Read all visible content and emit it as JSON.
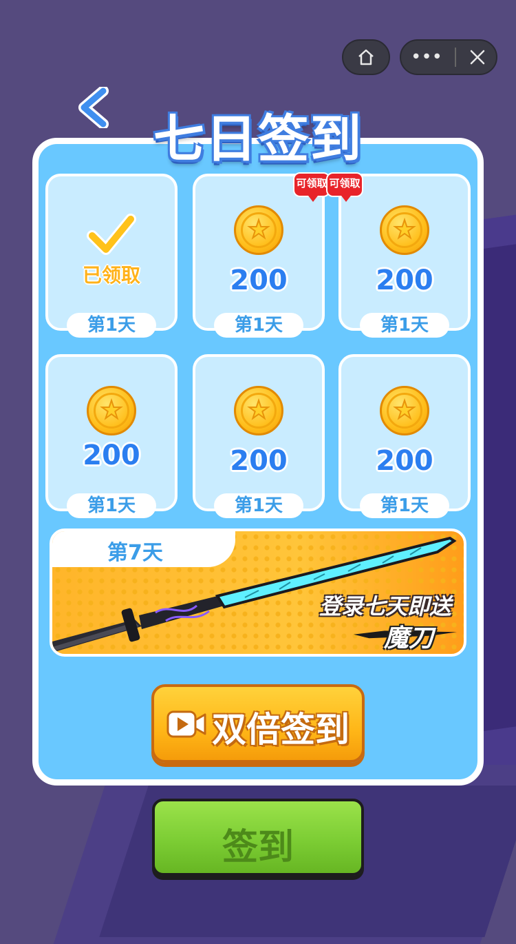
{
  "capsule": {
    "home_icon": "home-icon",
    "more_icon": "more-dots-icon",
    "close_icon": "close-icon"
  },
  "header": {
    "back_icon": "chevron-left-icon",
    "title": "七日签到"
  },
  "cards": [
    {
      "state": "claimed",
      "claimed_label": "已领取",
      "day_label": "第1天"
    },
    {
      "state": "available",
      "badge": "可领取",
      "amount": "200",
      "day_label": "第1天"
    },
    {
      "state": "available",
      "badge": "可领取",
      "amount": "200",
      "day_label": "第1天"
    },
    {
      "state": "locked",
      "amount": "200",
      "day_label": "第1天"
    },
    {
      "state": "locked",
      "amount": "200",
      "day_label": "第1天"
    },
    {
      "state": "locked",
      "amount": "200",
      "day_label": "第1天"
    }
  ],
  "day7": {
    "day_label": "第7天",
    "promo_text": "登录七天即送",
    "prize_text": "魔刀"
  },
  "buttons": {
    "double_label": "双倍签到",
    "double_icon": "video-icon",
    "sign_label": "签到"
  },
  "colors": {
    "panel": "#69c8ff",
    "title_outline": "#3f7de0",
    "coin": "#ffbe1a",
    "badge": "#e8242a",
    "double_button": "#ffb617",
    "sign_button": "#7ccd34"
  }
}
